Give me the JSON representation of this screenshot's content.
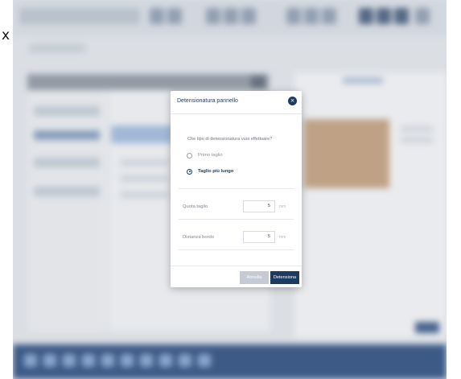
{
  "outer_glyph": "x",
  "dialog": {
    "title": "Detensionatura pannello",
    "close_icon": "×",
    "question": "Che tipo di detensionatura vuoi effettuare?",
    "options": [
      {
        "label": "Primo taglio",
        "selected": false
      },
      {
        "label": "Taglio più lungo",
        "selected": true
      }
    ],
    "fields": [
      {
        "label": "Quota taglio",
        "value": "5",
        "unit": "mm"
      },
      {
        "label": "Distanza bordo",
        "value": "5",
        "unit": "mm"
      }
    ],
    "cancel_label": "Annulla",
    "confirm_label": "Detensiona"
  },
  "colors": {
    "primary": "#1f3a5f",
    "taskbar": "#3f5e8c",
    "cancel_button": "#c4cbd4"
  }
}
